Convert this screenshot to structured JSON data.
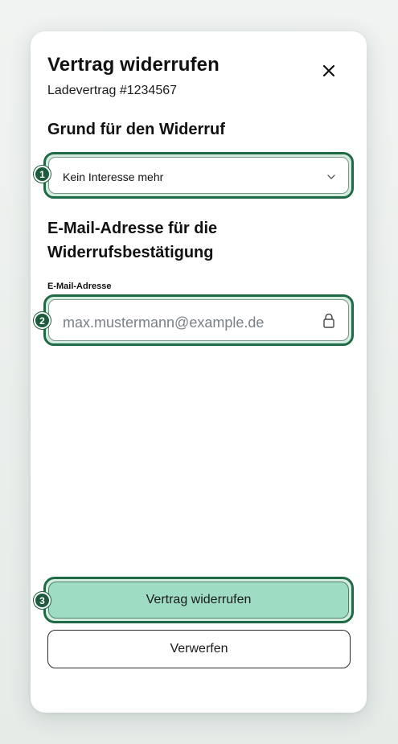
{
  "dialog": {
    "title": "Vertrag widerrufen",
    "subtitle": "Ladevertrag #1234567",
    "close_icon": "close-icon"
  },
  "reason_section": {
    "heading": "Grund für den Widerruf",
    "badge": "1",
    "select": {
      "value": "Kein Interesse mehr",
      "icon": "chevron-down-icon"
    }
  },
  "email_section": {
    "heading": "E-Mail-Adresse für die Widerrufsbestätigung",
    "field_label": "E-Mail-Adresse",
    "badge": "2",
    "input": {
      "value": "max.mustermann@example.de",
      "icon": "lock-icon",
      "locked": true
    }
  },
  "actions": {
    "primary_badge": "3",
    "primary_label": "Vertrag widerrufen",
    "secondary_label": "Verwerfen"
  },
  "colors": {
    "focus_ring": "#1f6a45",
    "badge": "#1c5c3c",
    "primary_button": "#9edcc3"
  }
}
